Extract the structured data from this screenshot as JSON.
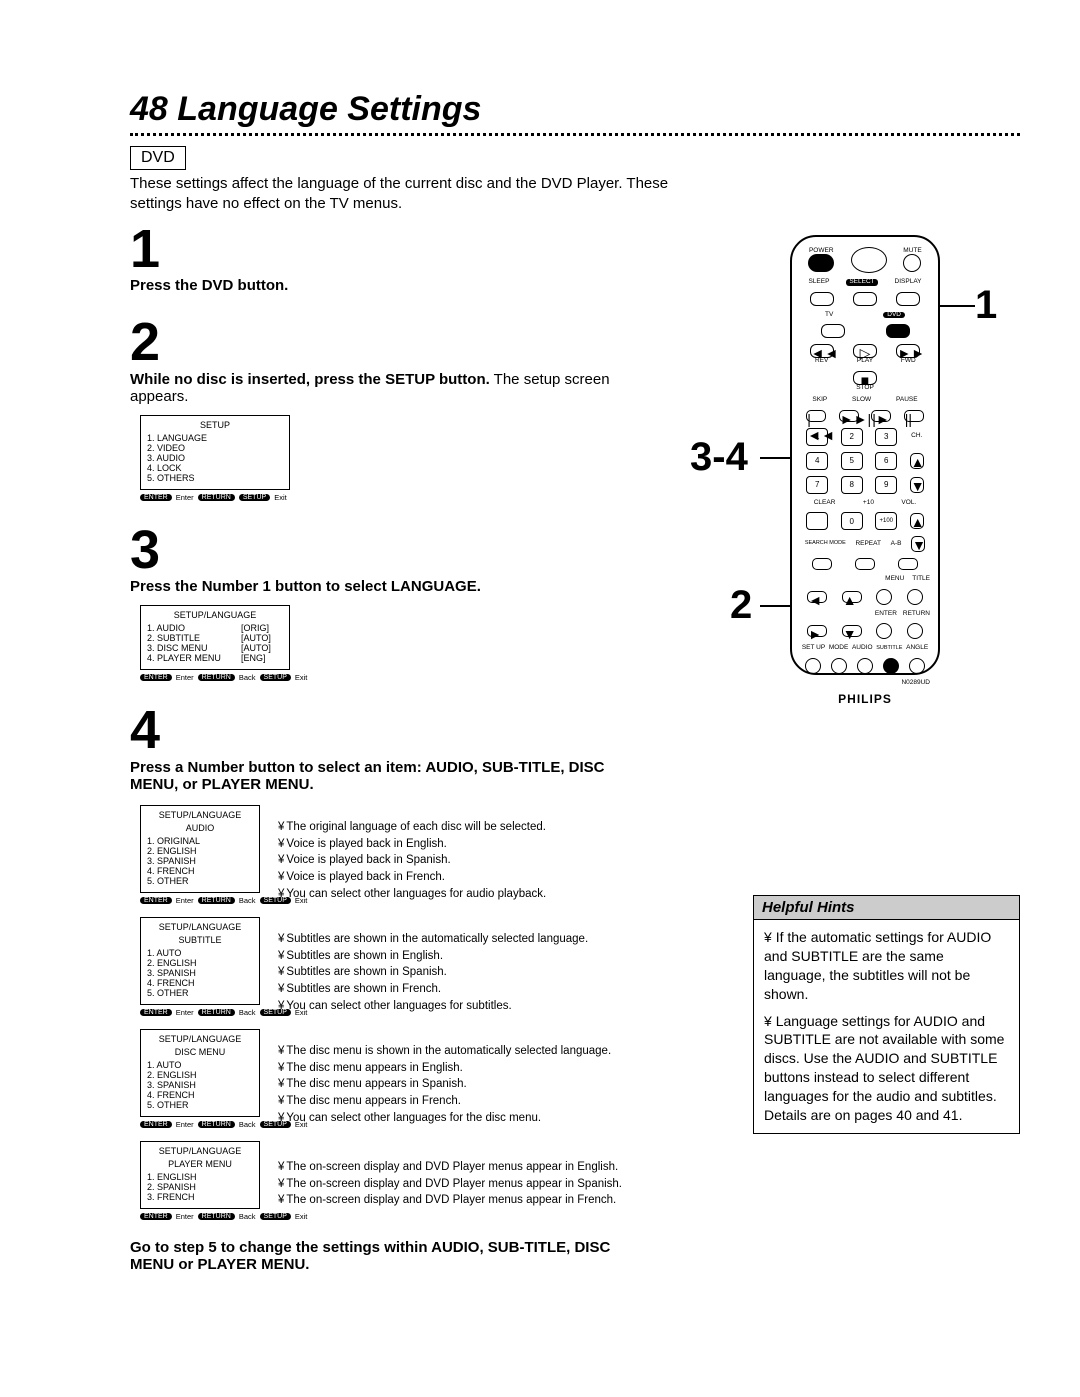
{
  "page_number": "48",
  "page_title": "Language Settings",
  "section_label": "DVD",
  "intro": "These settings affect the language of the current disc and the DVD Player. These settings have no effect on the TV menus.",
  "steps": {
    "s1": {
      "num": "1",
      "text_bold": "Press the DVD button."
    },
    "s2": {
      "num": "2",
      "text_bold": "While no disc is inserted, press the SETUP button.",
      "text_rest": " The setup screen appears."
    },
    "s3": {
      "num": "3",
      "text_bold": "Press the Number 1 button to select LANGUAGE."
    },
    "s4": {
      "num": "4",
      "text_bold": "Press a Number button to select an item: AUDIO, SUB-TITLE, DISC MENU, or PLAYER MENU."
    }
  },
  "goto": "Go to step 5 to change the settings within AUDIO, SUB-TITLE, DISC MENU or PLAYER MENU.",
  "osd_setup": {
    "title": "SETUP",
    "items": [
      "1. LANGUAGE",
      "2. VIDEO",
      "3. AUDIO",
      "4. LOCK",
      "5. OTHERS"
    ],
    "foot": {
      "enter": "ENTER",
      "enter_t": "Enter",
      "return": "RETURN",
      "setup": "SETUP",
      "exit": "Exit"
    }
  },
  "osd_lang": {
    "title": "SETUP/LANGUAGE",
    "items": [
      {
        "l": "1. AUDIO",
        "r": "[ORIG]"
      },
      {
        "l": "2. SUBTITLE",
        "r": "[AUTO]"
      },
      {
        "l": "3. DISC MENU",
        "r": "[AUTO]"
      },
      {
        "l": "4. PLAYER MENU",
        "r": "[ENG]"
      }
    ],
    "foot": {
      "enter": "ENTER",
      "enter_t": "Enter",
      "return": "RETURN",
      "back": "Back",
      "setup": "SETUP",
      "exit": "Exit"
    }
  },
  "osd_audio": {
    "title1": "SETUP/LANGUAGE",
    "title2": "AUDIO",
    "items": [
      "1. ORIGINAL",
      "2. ENGLISH",
      "3. SPANISH",
      "4. FRENCH",
      "5. OTHER"
    ],
    "explain": [
      "The original language of each disc will be selected.",
      "Voice is played back in English.",
      "Voice is played back in Spanish.",
      "Voice is played back in French.",
      "You can select other languages for audio playback."
    ]
  },
  "osd_sub": {
    "title1": "SETUP/LANGUAGE",
    "title2": "SUBTITLE",
    "items": [
      "1. AUTO",
      "2. ENGLISH",
      "3. SPANISH",
      "4. FRENCH",
      "5. OTHER"
    ],
    "explain": [
      "Subtitles are shown in the automatically selected language.",
      "Subtitles are shown in English.",
      "Subtitles are shown in Spanish.",
      "Subtitles are shown in French.",
      "You can select other languages for subtitles."
    ]
  },
  "osd_disc": {
    "title1": "SETUP/LANGUAGE",
    "title2": "DISC MENU",
    "items": [
      "1. AUTO",
      "2. ENGLISH",
      "3. SPANISH",
      "4. FRENCH",
      "5. OTHER"
    ],
    "explain": [
      "The disc menu is shown in the automatically selected language.",
      "The disc menu appears in English.",
      "The disc menu appears in Spanish.",
      "The disc menu appears in French.",
      "You can select other languages for the disc menu."
    ]
  },
  "osd_player": {
    "title1": "SETUP/LANGUAGE",
    "title2": "PLAYER MENU",
    "items": [
      "1. ENGLISH",
      "2. SPANISH",
      "3. FRENCH"
    ],
    "explain": [
      "The on-screen display and DVD Player menus appear in English.",
      "The on-screen display and DVD Player menus appear in Spanish.",
      "The on-screen display and DVD Player menus appear in French."
    ]
  },
  "osd_foot_back": {
    "enter": "ENTER",
    "enter_t": "Enter",
    "return": "RETURN",
    "back": "Back",
    "setup": "SETUP",
    "exit": "Exit"
  },
  "remote": {
    "labels": {
      "power": "POWER",
      "mute": "MUTE",
      "sleep": "SLEEP",
      "select": "SELECT",
      "display": "DISPLAY",
      "tv": "TV",
      "dvd": "DVD",
      "play": "PLAY",
      "rev": "REV",
      "fwd": "FWD",
      "stop": "STOP",
      "skip": "SKIP",
      "slow": "SLOW",
      "pause": "PAUSE",
      "ch": "CH.",
      "clear": "CLEAR",
      "plus10": "+10",
      "plus100": "+100",
      "vol": "VOL.",
      "searchmode": "SEARCH MODE",
      "repeat": "REPEAT",
      "ab": "A-B",
      "menu": "MENU",
      "title": "TITLE",
      "enter": "ENTER",
      "return": "RETURN",
      "setup": "SET UP",
      "mode": "MODE",
      "audio": "AUDIO",
      "subtitle": "SUBTITLE",
      "angle": "ANGLE",
      "model": "N0289UD",
      "brand": "PHILIPS"
    },
    "numbers": [
      "1",
      "2",
      "3",
      "4",
      "5",
      "6",
      "7",
      "8",
      "9",
      "0"
    ]
  },
  "callouts": {
    "c1": "1",
    "c2": "2",
    "c34": "3-4"
  },
  "hints": {
    "title": "Helpful Hints",
    "items": [
      "If the automatic settings for AUDIO and SUBTITLE are the same language, the subtitles will not be shown.",
      "Language settings for AUDIO and SUBTITLE are not available with some discs. Use the AUDIO and SUBTITLE buttons instead to select different languages for the audio and subtitles. Details are on pages 40 and 41."
    ]
  }
}
